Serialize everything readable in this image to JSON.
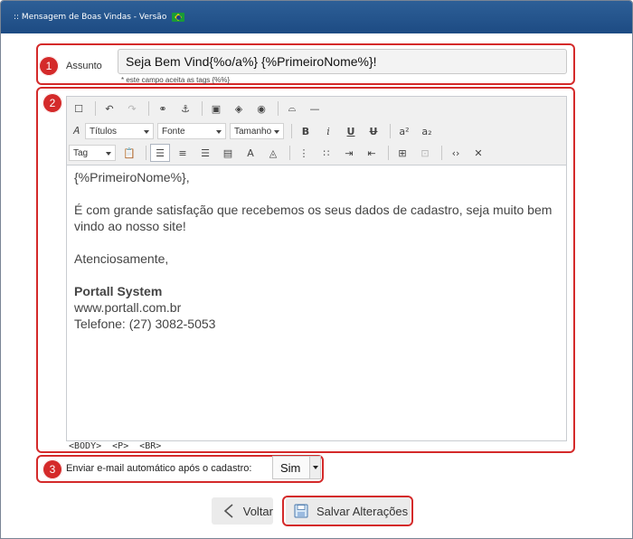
{
  "window": {
    "title": ":: Mensagem de Boas Vindas - Versão"
  },
  "markers": {
    "one": "1",
    "two": "2",
    "three": "3"
  },
  "subject": {
    "label": "Assunto",
    "value": "Seja Bem Vind{%o/a%} {%PrimeiroNome%}!",
    "hint": "* este campo aceita as tags {%%}"
  },
  "toolbar": {
    "titulos": "Títulos",
    "fonte": "Fonte",
    "tamanho": "Tamanho",
    "tag": "Tag",
    "bold": "B",
    "italic": "i",
    "underline": "U",
    "strike": "U",
    "superscript": "a²",
    "subscript": "a₂"
  },
  "editor": {
    "line1": "{%PrimeiroNome%},",
    "line2": "É com grande satisfação que recebemos os seus dados de cadastro, seja muito bem vindo ao nosso site!",
    "line3": "Atenciosamente,",
    "company": "Portall System",
    "site": "www.portall.com.br",
    "phone": "Telefone: (27) 3082-5053",
    "status_path": [
      "<BODY>",
      "<P>",
      "<BR>"
    ]
  },
  "auto_email": {
    "label": "Enviar e-mail automático após o cadastro:",
    "value": "Sim"
  },
  "buttons": {
    "back": "Voltar",
    "save": "Salvar Alterações"
  },
  "colors": {
    "titlebar": "#1d4b83",
    "highlight": "#d42a2a"
  }
}
